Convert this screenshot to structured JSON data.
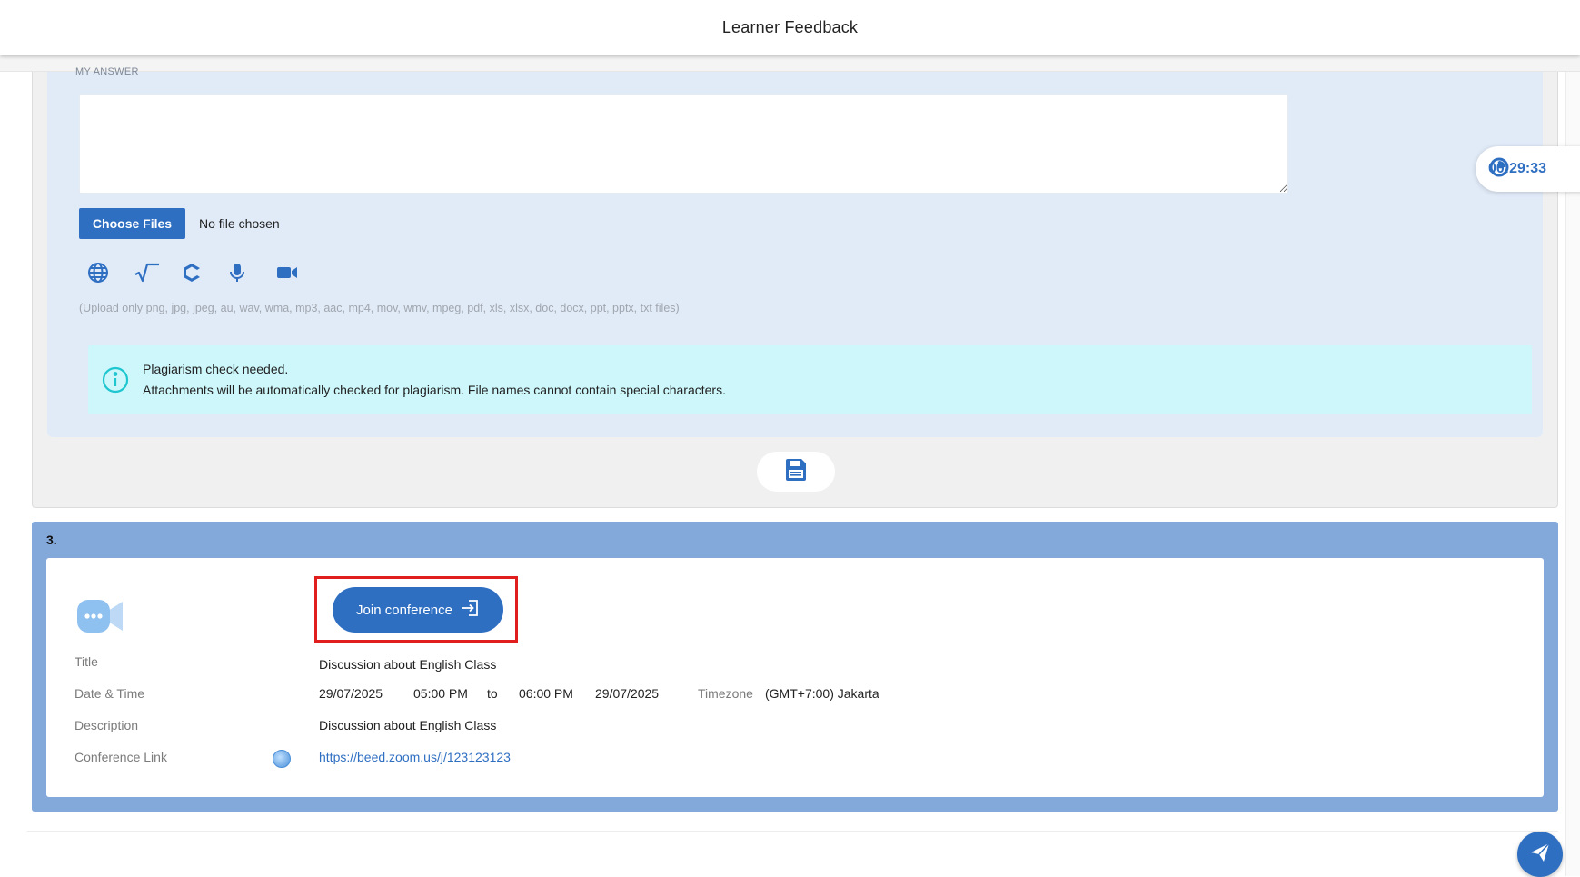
{
  "header": {
    "title": "Learner Feedback"
  },
  "timer": {
    "value": "00:29:33"
  },
  "question2": {
    "my_answer_label": "MY ANSWER",
    "answer_value": "",
    "choose_files_label": "Choose Files",
    "no_file_text": "No file chosen",
    "tools": [
      "globe-icon",
      "square-root-icon",
      "code-icon",
      "microphone-icon",
      "video-camera-icon"
    ],
    "upload_hint": "(Upload only png, jpg, jpeg, au, wav, wma, mp3, aac, mp4, mov, wmv, mpeg, pdf, xls, xlsx, doc, docx, ppt, pptx, txt files)",
    "alert": {
      "line1": "Plagiarism check needed.",
      "line2": "Attachments will be automatically checked for plagiarism. File names cannot contain special characters."
    },
    "save_icon": "floppy-disk-icon"
  },
  "question3": {
    "number": "3.",
    "join_label": "Join conference",
    "title_label": "Title",
    "title_value": "Discussion about English Class",
    "datetime_label": "Date & Time",
    "start_date": "29/07/2025",
    "start_time": "05:00 PM",
    "to_text": "to",
    "end_time": "06:00 PM",
    "end_date": "29/07/2025",
    "timezone_label": "Timezone",
    "timezone_value": "(GMT+7:00) Jakarta",
    "description_label": "Description",
    "description_value": "Discussion about English Class",
    "link_label": "Conference Link",
    "link_value": "https://beed.zoom.us/j/123123123"
  },
  "colors": {
    "accent": "#2f6fc2",
    "panel": "#e1ebf8",
    "q3_header": "#83a9db",
    "alert": "#cdf7fb",
    "highlight": "#e01e1e"
  }
}
